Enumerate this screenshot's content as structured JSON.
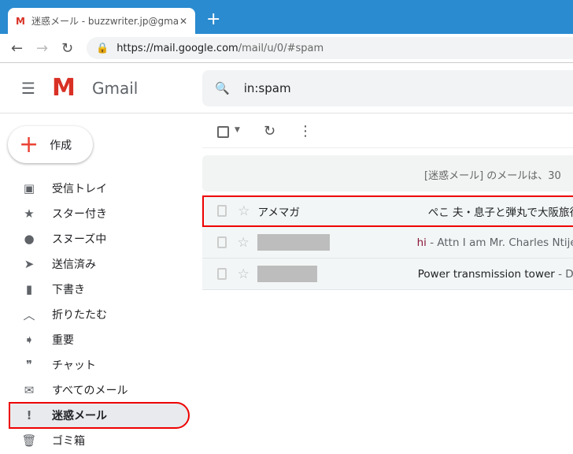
{
  "browser": {
    "tab_title": "迷惑メール - buzzwriter.jp@gmail.com",
    "url_host": "https://mail.google.com",
    "url_path": "/mail/u/0/#spam"
  },
  "app": {
    "name": "Gmail",
    "search_value": "in:spam",
    "compose_label": "作成"
  },
  "sidebar": {
    "items": [
      {
        "label": "受信トレイ",
        "icon": "inbox-icon",
        "glyph": "▣"
      },
      {
        "label": "スター付き",
        "icon": "star-icon",
        "glyph": "★"
      },
      {
        "label": "スヌーズ中",
        "icon": "clock-icon",
        "glyph": "●"
      },
      {
        "label": "送信済み",
        "icon": "send-icon",
        "glyph": "➤"
      },
      {
        "label": "下書き",
        "icon": "draft-icon",
        "glyph": "▮"
      },
      {
        "label": "折りたたむ",
        "icon": "chevron-up-icon",
        "glyph": "︿"
      },
      {
        "label": "重要",
        "icon": "important-icon",
        "glyph": "➧"
      },
      {
        "label": "チャット",
        "icon": "chat-icon",
        "glyph": "❞"
      },
      {
        "label": "すべてのメール",
        "icon": "mail-icon",
        "glyph": "✉"
      },
      {
        "label": "迷惑メール",
        "icon": "spam-icon",
        "glyph": "!",
        "active": true
      },
      {
        "label": "ゴミ箱",
        "icon": "trash-icon",
        "glyph": "🗑"
      }
    ]
  },
  "main": {
    "banner": "[迷惑メール] のメールは、30",
    "rows": [
      {
        "sender": "アメマガ",
        "subject": "ぺこ 夫・息子と弾丸で大阪旅行",
        "snippet": ""
      },
      {
        "sender": "",
        "subject": "hi",
        "snippet": " - Attn I am Mr. Charles Ntije,"
      },
      {
        "sender": "",
        "subject": "Power transmission tower",
        "snippet": " - De"
      }
    ]
  },
  "colors": {
    "accent": "#2a8bd0",
    "highlight": "#e00000"
  }
}
